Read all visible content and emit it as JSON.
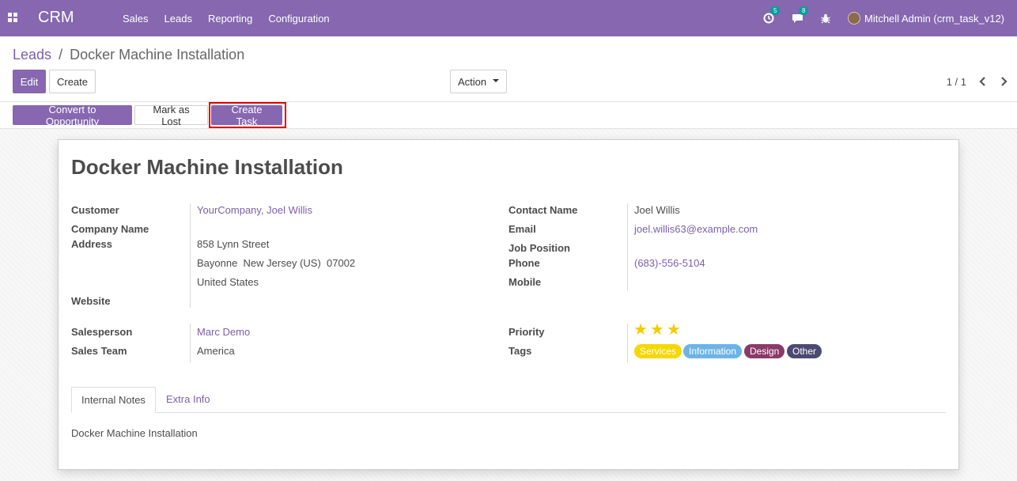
{
  "navbar": {
    "brand": "CRM",
    "menu": [
      "Sales",
      "Leads",
      "Reporting",
      "Configuration"
    ],
    "activity_badge": "5",
    "messages_badge": "8",
    "user": "Mitchell Admin (crm_task_v12)"
  },
  "breadcrumb": {
    "parent": "Leads",
    "separator": "/",
    "current": "Docker Machine Installation"
  },
  "buttons": {
    "edit": "Edit",
    "create": "Create",
    "action": "Action"
  },
  "pager": {
    "value": "1 / 1"
  },
  "statusbar": {
    "convert": "Convert to Opportunity",
    "mark_lost": "Mark as Lost",
    "create_task": "Create Task"
  },
  "record": {
    "title": "Docker Machine Installation",
    "left": {
      "customer_label": "Customer",
      "customer": "YourCompany, Joel Willis",
      "company_label": "Company Name",
      "address_label": "Address",
      "street": "858 Lynn Street",
      "city_line": "Bayonne  New Jersey (US)  07002",
      "country": "United States",
      "website_label": "Website",
      "salesperson_label": "Salesperson",
      "salesperson": "Marc Demo",
      "team_label": "Sales Team",
      "team": "America"
    },
    "right": {
      "contact_label": "Contact Name",
      "contact": "Joel Willis",
      "email_label": "Email",
      "email": "joel.willis63@example.com",
      "job_label": "Job Position",
      "phone_label": "Phone",
      "phone": "(683)-556-5104",
      "mobile_label": "Mobile",
      "priority_label": "Priority",
      "priority_stars": 3,
      "tags_label": "Tags",
      "tags": [
        {
          "name": "Services",
          "color": "#f5d800"
        },
        {
          "name": "Information",
          "color": "#6cb4e8"
        },
        {
          "name": "Design",
          "color": "#8a3a69"
        },
        {
          "name": "Other",
          "color": "#4b4a73"
        }
      ]
    }
  },
  "tabs": {
    "internal_notes": "Internal Notes",
    "extra_info": "Extra Info"
  },
  "notes": "Docker Machine Installation"
}
